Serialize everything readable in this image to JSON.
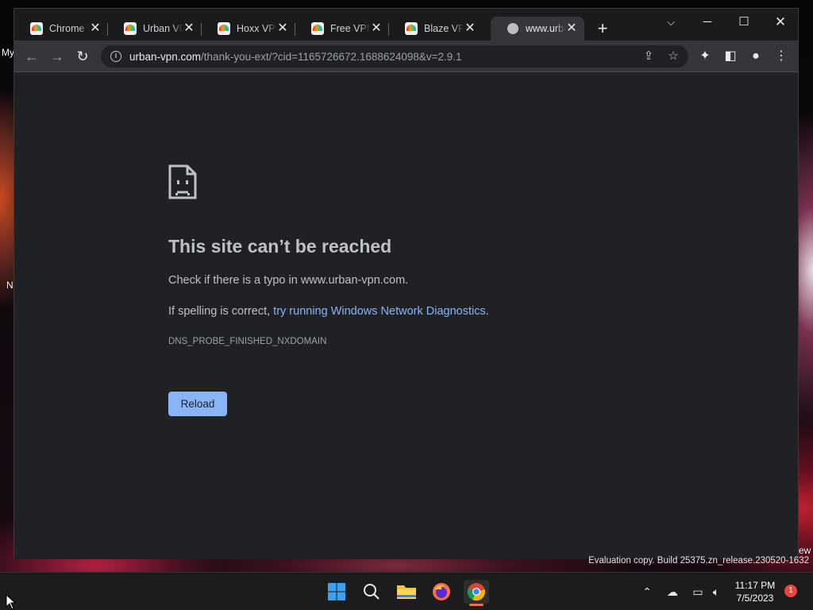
{
  "desktop": {
    "label_top": "My",
    "label_mid": "N",
    "label_right": "ew"
  },
  "browser": {
    "tabs": [
      {
        "title": "Chrome Web Store",
        "icon": "vpn-favicon",
        "active": false
      },
      {
        "title": "Urban VPN",
        "icon": "vpn-favicon",
        "active": false
      },
      {
        "title": "Hoxx VPN",
        "icon": "vpn-favicon",
        "active": false
      },
      {
        "title": "Free VPN",
        "icon": "vpn-favicon",
        "active": false
      },
      {
        "title": "Blaze VPN",
        "icon": "vpn-favicon",
        "active": false
      },
      {
        "title": "www.urban-vpn.com",
        "icon": "globe-icon",
        "active": true
      }
    ],
    "url_domain": "urban-vpn.com",
    "url_path": "/thank-you-ext/?cid=1165726672.1688624098&v=2.9.1"
  },
  "error_page": {
    "title": "This site can’t be reached",
    "line1": "Check if there is a typo in www.urban-vpn.com.",
    "line2_prefix": "If spelling is correct, ",
    "line2_link": "try running Windows Network Diagnostics",
    "line2_suffix": ".",
    "code": "DNS_PROBE_FINISHED_NXDOMAIN",
    "reload_label": "Reload"
  },
  "watermark": "Evaluation copy. Build 25375.zn_release.230520-1632",
  "taskbar": {
    "time": "11:17 PM",
    "date": "7/5/2023",
    "notification_count": "1"
  },
  "colors": {
    "link": "#8ab4f8",
    "button": "#8ab4f8",
    "page_bg": "#202124"
  }
}
